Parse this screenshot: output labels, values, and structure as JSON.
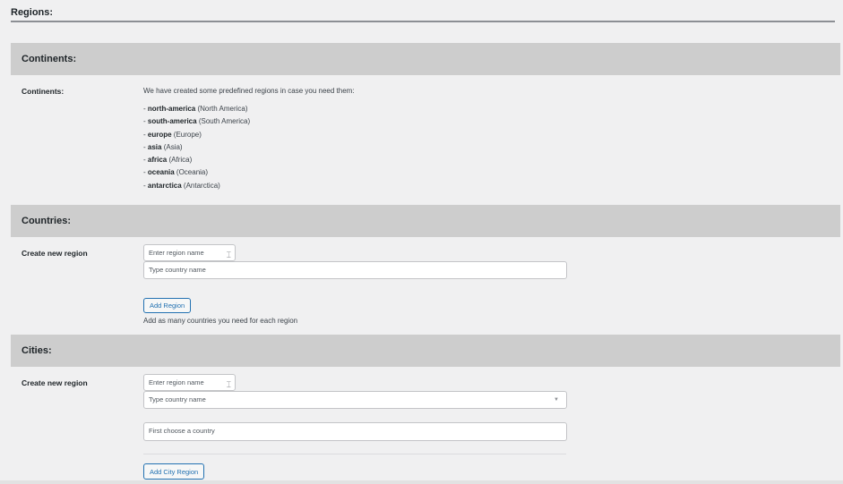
{
  "page": {
    "title": "Regions:"
  },
  "continents": {
    "header": "Continents:",
    "label": "Continents:",
    "intro": "We have created some predefined regions in case you need them:",
    "items": [
      {
        "slug": "north-america",
        "name": "(North America)"
      },
      {
        "slug": "south-america",
        "name": "(South America)"
      },
      {
        "slug": "europe",
        "name": "(Europe)"
      },
      {
        "slug": "asia",
        "name": "(Asia)"
      },
      {
        "slug": "africa",
        "name": "(Africa)"
      },
      {
        "slug": "oceania",
        "name": "(Oceania)"
      },
      {
        "slug": "antarctica",
        "name": "(Antarctica)"
      }
    ]
  },
  "countries": {
    "header": "Countries:",
    "label": "Create new region",
    "region_name_placeholder": "Enter region name",
    "country_placeholder": "Type country name",
    "add_button": "Add Region",
    "help": "Add as many countries you need for each region"
  },
  "cities": {
    "header": "Cities:",
    "label": "Create new region",
    "region_name_placeholder": "Enter region name",
    "country_placeholder": "Type country name",
    "city_placeholder": "First choose a country",
    "add_button": "Add City Region"
  },
  "colors": {
    "header_bg": "#cdcdcd",
    "button_accent": "#2271b1",
    "page_bg": "#f0f0f1"
  }
}
